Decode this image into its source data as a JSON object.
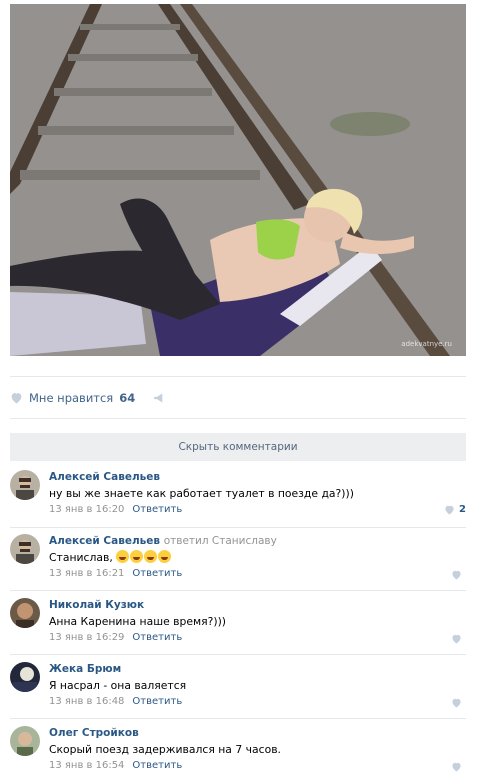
{
  "photo": {
    "watermark": "adekvatnye.ru"
  },
  "post_actions": {
    "like_label": "Мне нравится",
    "like_count": "64",
    "heart_icon": "heart-icon",
    "share_icon": "share-icon"
  },
  "hide_comments_label": "Скрыть комментарии",
  "comments": [
    {
      "author": "Алексей Савельев",
      "reply_to": "",
      "text": "ну вы же знаете как работает туалет в поезде да?)))",
      "time": "13 янв в 16:20",
      "reply_label": "Ответить",
      "likes": "2"
    },
    {
      "author": "Алексей Савельев",
      "reply_to": "ответил Станиславу",
      "text": "Станислав,",
      "emoji_count": 4,
      "time": "13 янв в 16:21",
      "reply_label": "Ответить",
      "likes": ""
    },
    {
      "author": "Николай Кузюк",
      "reply_to": "",
      "text": "Анна Каренина наше время?)))",
      "time": "13 янв в 16:29",
      "reply_label": "Ответить",
      "likes": ""
    },
    {
      "author": "Жека Брюм",
      "reply_to": "",
      "text": "Я насрал - она валяется",
      "time": "13 янв в 16:48",
      "reply_label": "Ответить",
      "likes": ""
    },
    {
      "author": "Олег Стройков",
      "reply_to": "",
      "text": "Скорый поезд задерживался на 7 часов.",
      "time": "13 янв в 16:54",
      "reply_label": "Ответить",
      "likes": ""
    }
  ],
  "colors": {
    "link": "#2a5885",
    "meta": "#939393",
    "hide_bar": "#edeef0",
    "heart_inactive": "#c5d0db"
  }
}
